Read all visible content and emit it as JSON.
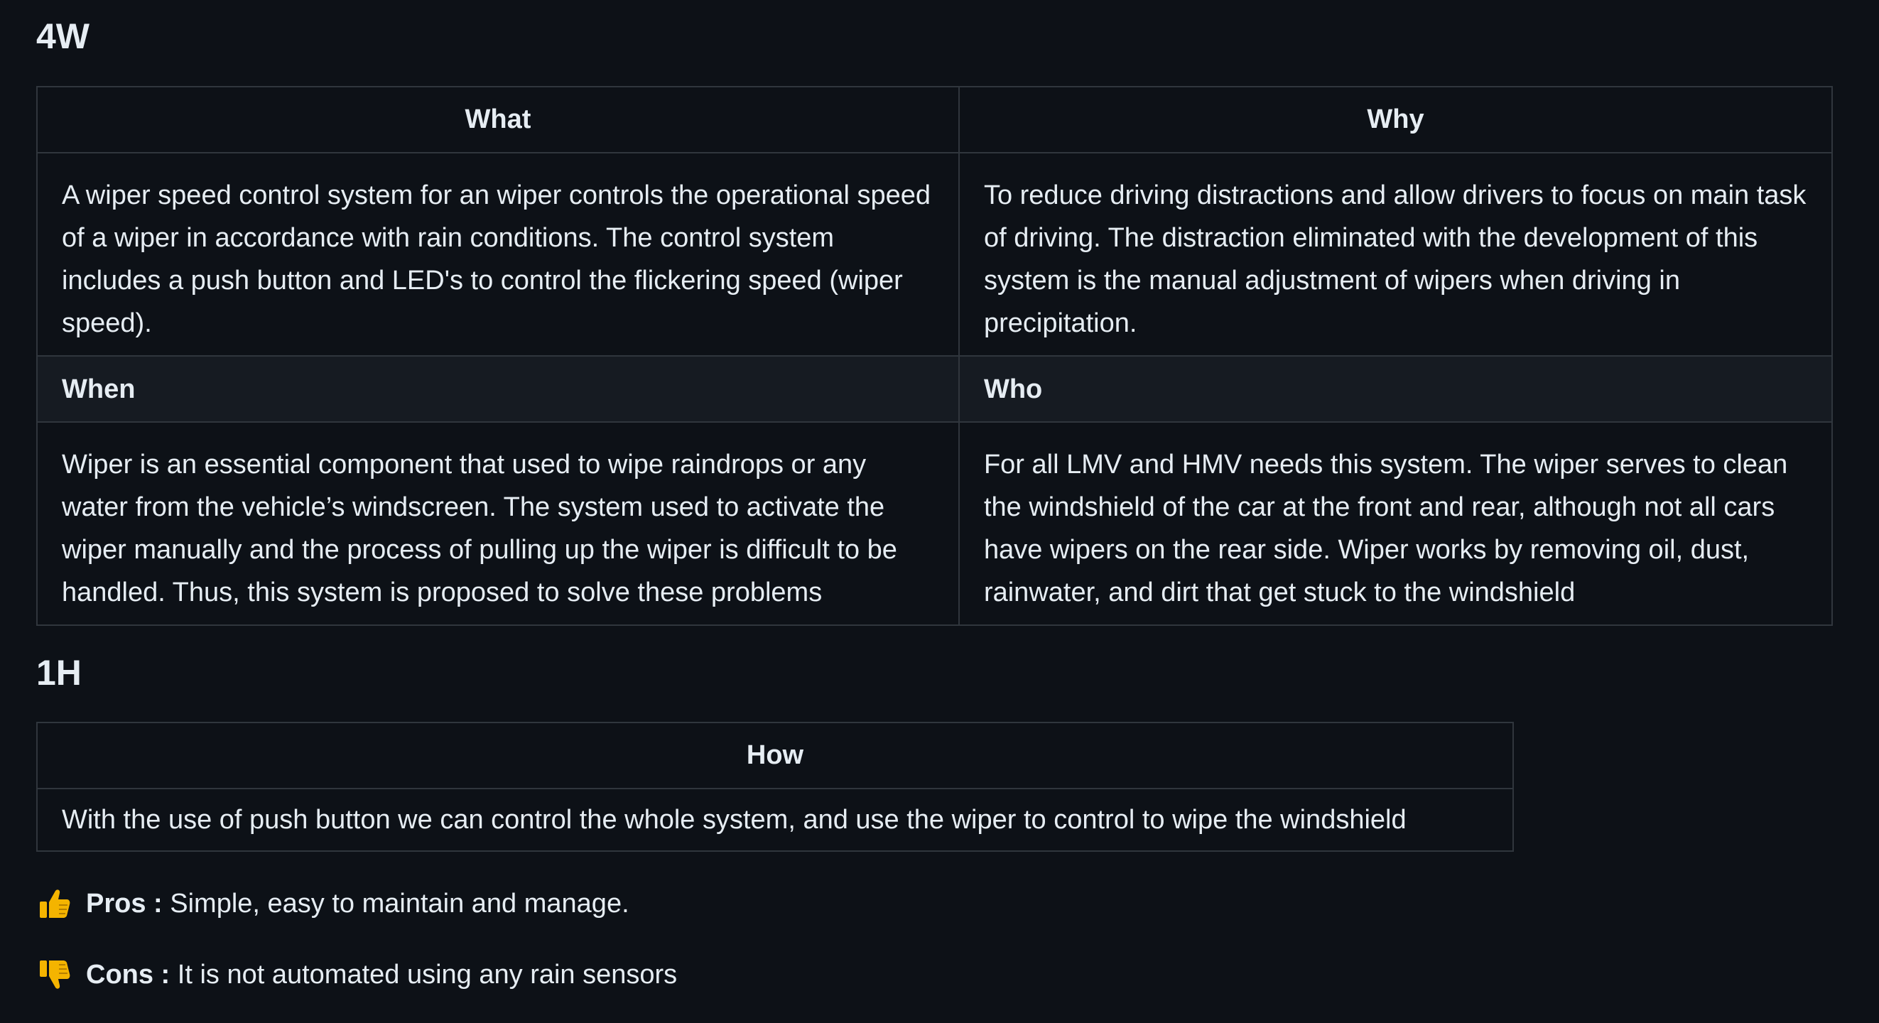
{
  "section_4w": {
    "title": "4W",
    "headers": {
      "what": "What",
      "why": "Why"
    },
    "what_text": "A wiper speed control system for an wiper controls the operational speed of a wiper in accordance with rain conditions. The control system includes a push button and LED's to control the flickering speed (wiper speed).",
    "why_text": "To reduce driving distractions and allow drivers to focus on main task of driving. The distraction eliminated with the development of this system is the manual adjustment of wipers when driving in precipitation.",
    "when_label": "When",
    "who_label": "Who",
    "when_text": "Wiper is an essential component that used to wipe raindrops or any water from the vehicle’s windscreen. The system used to activate the wiper manually and the process of pulling up the wiper is difficult to be handled. Thus, this system is proposed to solve these problems",
    "who_text": "For all LMV and HMV needs this system. The wiper serves to clean the windshield of the car at the front and rear, although not all cars have wipers on the rear side. Wiper works by removing oil, dust, rainwater, and dirt that get stuck to the windshield"
  },
  "section_1h": {
    "title": "1H",
    "header_how": "How",
    "how_text": "With the use of push button we can control the whole system, and use the wiper to control to wipe the windshield"
  },
  "pros": {
    "icon": "thumbs-up-icon",
    "label": "Pros :",
    "text": " Simple, easy to maintain and manage."
  },
  "cons": {
    "icon": "thumbs-down-icon",
    "label": "Cons :",
    "text": " It is not automated using any rain sensors"
  },
  "colors": {
    "background": "#0d1117",
    "text": "#e6edf3",
    "border": "#30363d",
    "alt_row": "#161b22",
    "emoji": "#f4b400"
  }
}
